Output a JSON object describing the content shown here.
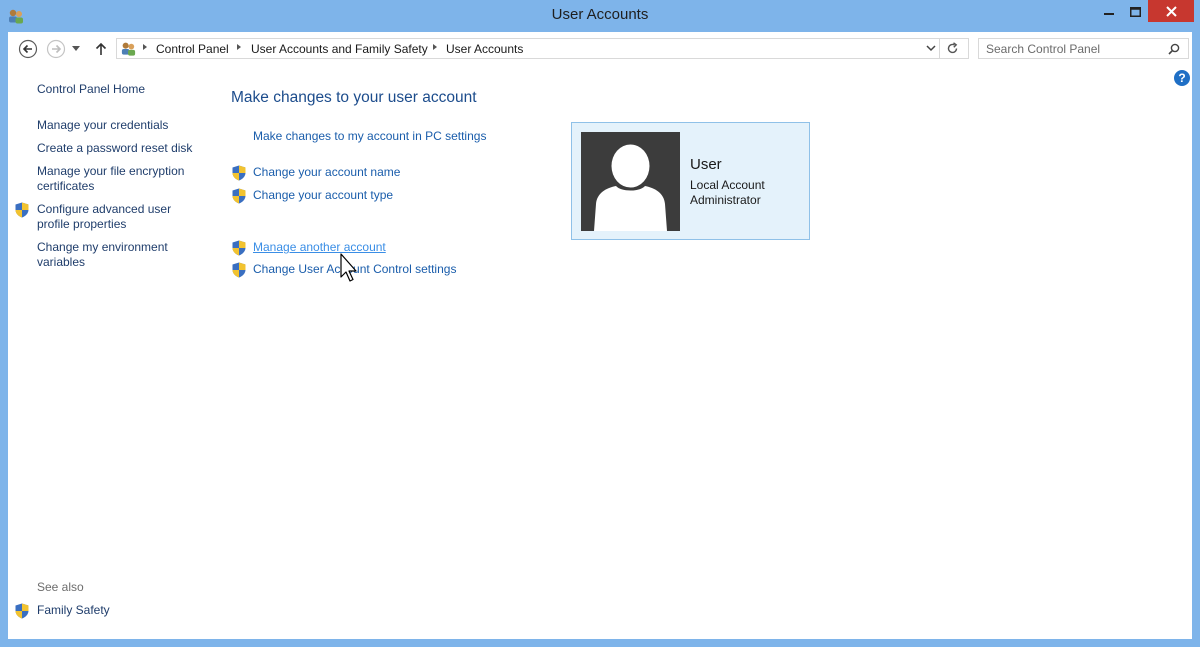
{
  "window": {
    "title": "User Accounts",
    "controls": {
      "minimize": "minimize",
      "maximize": "maximize",
      "close": "close"
    }
  },
  "nav": {
    "breadcrumb": [
      "Control Panel",
      "User Accounts and Family Safety",
      "User Accounts"
    ],
    "search_placeholder": "Search Control Panel"
  },
  "sidebar": {
    "home": "Control Panel Home",
    "items": [
      {
        "label": "Manage your credentials",
        "shield": false
      },
      {
        "label": "Create a password reset disk",
        "shield": false
      },
      {
        "label": "Manage your file encryption certificates",
        "shield": false
      },
      {
        "label": "Configure advanced user profile properties",
        "shield": true
      },
      {
        "label": "Change my environment variables",
        "shield": false
      }
    ],
    "see_also_label": "See also",
    "see_also_items": [
      {
        "label": "Family Safety",
        "shield": true
      }
    ]
  },
  "main": {
    "heading": "Make changes to your user account",
    "links": [
      {
        "label": "Make changes to my account in PC settings",
        "shield": false
      },
      {
        "label": "Change your account name",
        "shield": true
      },
      {
        "label": "Change your account type",
        "shield": true
      },
      {
        "label": "Manage another account",
        "shield": true,
        "hovered": true
      },
      {
        "label": "Change User Account Control settings",
        "shield": true
      }
    ]
  },
  "account_card": {
    "name": "User",
    "type": "Local Account",
    "role": "Administrator"
  },
  "colors": {
    "frame": "#7eb4ea",
    "link": "#1a5dab",
    "close_button": "#c7372f",
    "card_bg": "#e4f2fb"
  }
}
